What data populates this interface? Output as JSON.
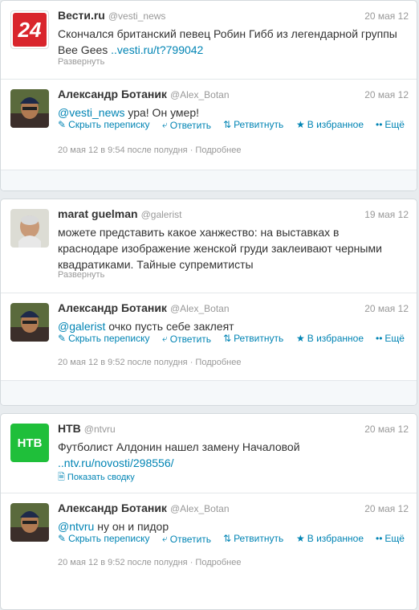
{
  "conversations": [
    {
      "original": {
        "name": "Вести.ru",
        "handle": "@vesti_news",
        "time": "20 мая 12",
        "text": "Скончался британский певец Робин Гибб из легендарной группы Bee Gees ",
        "link": "..vesti.ru/t?799042",
        "expand": "Развернуть",
        "avatar_text": "24",
        "avatar_color": "#d9252c"
      },
      "reply": {
        "name": "Александр Ботаник",
        "handle": "@Alex_Botan",
        "time": "20 мая 12",
        "mention": "@vesti_news",
        "text": " ура! Он умер!",
        "meta": "20 мая 12 в 9:54 после полудня · Подробнее"
      }
    },
    {
      "original": {
        "name": "marat guelman",
        "handle": "@galerist",
        "time": "19 мая 12",
        "text": "можете представить какое ханжество: на выставках в краснодаре изображение женской груди заклеивают черными квадратиками. Тайные супремитисты",
        "expand": "Развернуть"
      },
      "reply": {
        "name": "Александр Ботаник",
        "handle": "@Alex_Botan",
        "time": "20 мая 12",
        "mention": "@galerist",
        "text": " очко пусть себе заклеят",
        "meta": "20 мая 12 в 9:52 после полудня · Подробнее"
      }
    },
    {
      "original": {
        "name": "НТВ",
        "handle": "@ntvru",
        "time": "20 мая 12",
        "text": "Футболист Алдонин нашел замену Началовой ",
        "link": "..ntv.ru/novosti/298556/",
        "expand": "Показать сводку",
        "avatar_text": "НТВ",
        "avatar_color": "#1fbf3a"
      },
      "reply": {
        "name": "Александр Ботаник",
        "handle": "@Alex_Botan",
        "time": "20 мая 12",
        "mention": "@ntvru",
        "text": " ну он и пидор",
        "meta": "20 мая 12 в 9:52 после полудня · Подробнее"
      }
    }
  ],
  "actions": {
    "hide": "Скрыть переписку",
    "reply": "Ответить",
    "retweet": "Ретвитнуть",
    "favorite": "В избранное",
    "more": "Ещё"
  },
  "colors": {
    "link": "#0084b4",
    "muted": "#999999",
    "bg": "#e8ecef"
  }
}
